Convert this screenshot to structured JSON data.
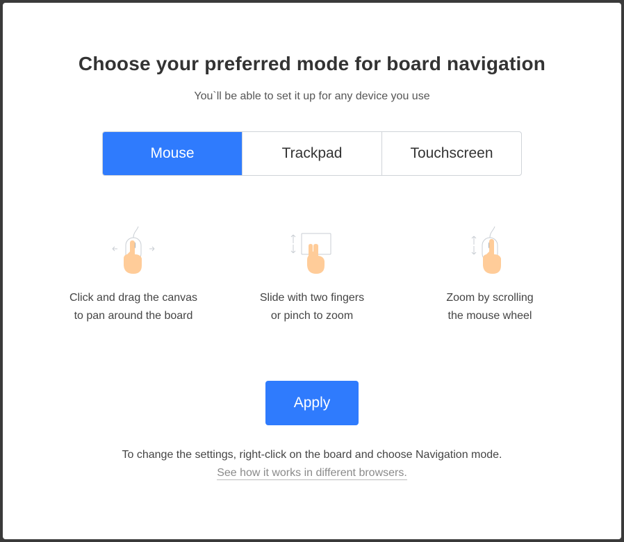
{
  "dialog": {
    "title": "Choose your preferred mode for board navigation",
    "subtitle": "You`ll be able to set it up for any device you use"
  },
  "modes": {
    "selected": "Mouse",
    "options": [
      "Mouse",
      "Trackpad",
      "Touchscreen"
    ]
  },
  "features": [
    {
      "icon": "mouse-drag-icon",
      "line1": "Click and drag the canvas",
      "line2": "to pan around the board"
    },
    {
      "icon": "trackpad-fingers-icon",
      "line1": "Slide with two fingers",
      "line2": "or pinch to zoom"
    },
    {
      "icon": "mouse-wheel-scroll-icon",
      "line1": "Zoom by scrolling",
      "line2": "the mouse wheel"
    }
  ],
  "apply_label": "Apply",
  "footer": {
    "text": "To change the settings, right-click on the board and choose Navigation mode.",
    "link": "See how it works in different browsers."
  },
  "colors": {
    "accent": "#2f7bfd",
    "skin": "#ffcc99",
    "border": "#cfd3d8"
  }
}
